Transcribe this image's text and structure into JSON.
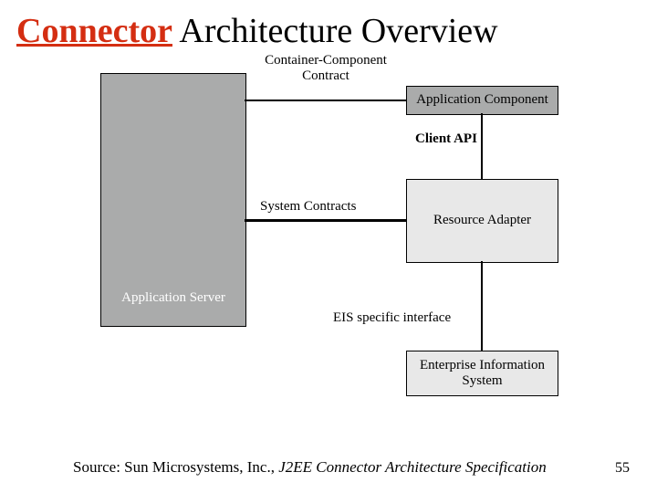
{
  "title": {
    "accent": "Connector",
    "rest": " Architecture Overview"
  },
  "labels": {
    "container_component_contract": "Container-Component\nContract",
    "client_api": "Client API",
    "system_contracts": "System Contracts",
    "eis_specific_interface": "EIS specific interface"
  },
  "boxes": {
    "application_server": "Application Server",
    "application_component": "Application Component",
    "resource_adapter": "Resource Adapter",
    "enterprise_information_system": "Enterprise Information\nSystem"
  },
  "source": {
    "prefix": "Source: Sun Microsystems, Inc., ",
    "italic": "J2EE Connector Architecture Specification"
  },
  "page_number": "55"
}
